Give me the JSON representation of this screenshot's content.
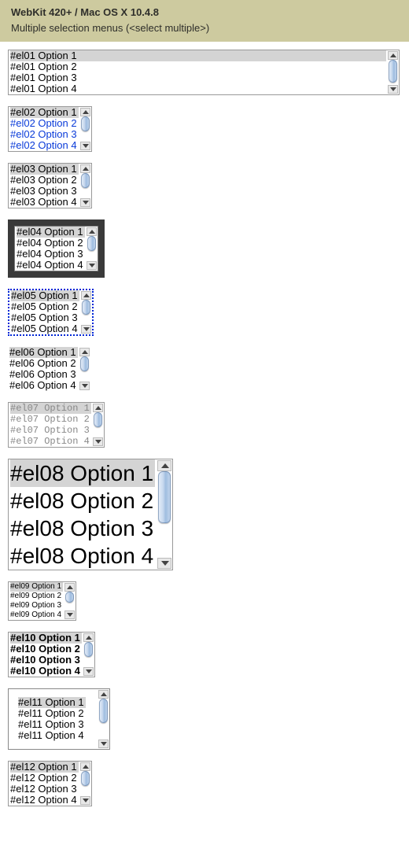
{
  "header": {
    "line1": "WebKit 420+ / Mac OS X 10.4.8",
    "line2_prefix": "Multiple selection menus (",
    "line2_code": "<select multiple>",
    "line2_suffix": ")"
  },
  "selects": [
    {
      "id": "el01",
      "variant": "full",
      "options": [
        "#el01 Option 1",
        "#el01 Option 2",
        "#el01 Option 3",
        "#el01 Option 4"
      ],
      "selected": 0
    },
    {
      "id": "el02",
      "variant": "blue",
      "options": [
        "#el02 Option 1",
        "#el02 Option 2",
        "#el02 Option 3",
        "#el02 Option 4"
      ],
      "selected": 0
    },
    {
      "id": "el03",
      "variant": "plain",
      "options": [
        "#el03 Option 1",
        "#el03 Option 2",
        "#el03 Option 3",
        "#el03 Option 4"
      ],
      "selected": 0
    },
    {
      "id": "el04",
      "variant": "thick",
      "options": [
        "#el04 Option 1",
        "#el04 Option 2",
        "#el04 Option 3",
        "#el04 Option 4"
      ],
      "selected": 0
    },
    {
      "id": "el05",
      "variant": "dotted",
      "options": [
        "#el05 Option 1",
        "#el05 Option 2",
        "#el05 Option 3",
        "#el05 Option 4"
      ],
      "selected": 0
    },
    {
      "id": "el06",
      "variant": "noborder",
      "options": [
        "#el06 Option 1",
        "#el06 Option 2",
        "#el06 Option 3",
        "#el06 Option 4"
      ],
      "selected": 0
    },
    {
      "id": "el07",
      "variant": "mono",
      "options": [
        "#el07 Option 1",
        "#el07 Option 2",
        "#el07 Option 3",
        "#el07 Option 4"
      ],
      "selected": 0
    },
    {
      "id": "el08",
      "variant": "big",
      "options": [
        "#el08 Option 1",
        "#el08 Option 2",
        "#el08 Option 3",
        "#el08 Option 4"
      ],
      "selected": 0
    },
    {
      "id": "el09",
      "variant": "small",
      "options": [
        "#el09 Option 1",
        "#el09 Option 2",
        "#el09 Option 3",
        "#el09 Option 4"
      ],
      "selected": 0
    },
    {
      "id": "el10",
      "variant": "bold",
      "options": [
        "#el10 Option 1",
        "#el10 Option 2",
        "#el10 Option 3",
        "#el10 Option 4"
      ],
      "selected": 0
    },
    {
      "id": "el11",
      "variant": "pad",
      "options": [
        "#el11 Option 1",
        "#el11 Option 2",
        "#el11 Option 3",
        "#el11 Option 4"
      ],
      "selected": 0
    },
    {
      "id": "el12",
      "variant": "plain",
      "options": [
        "#el12 Option 1",
        "#el12 Option 2",
        "#el12 Option 3",
        "#el12 Option 4"
      ],
      "selected": 0
    }
  ]
}
